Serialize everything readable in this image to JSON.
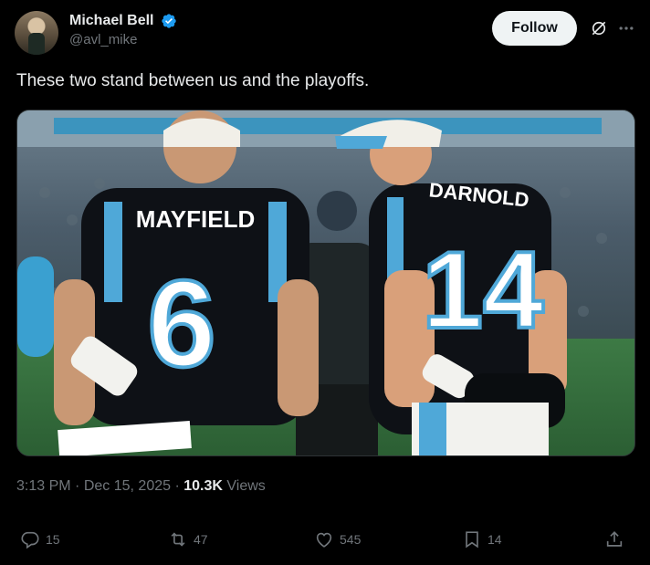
{
  "author": {
    "display_name": "Michael Bell",
    "handle": "@avl_mike",
    "verified": true
  },
  "follow_label": "Follow",
  "icons": {
    "verified": "verified-badge-icon",
    "grok": "grok-icon",
    "more": "more-icon",
    "reply": "reply-icon",
    "retweet": "retweet-icon",
    "like": "heart-icon",
    "bookmark": "bookmark-icon",
    "share": "share-icon"
  },
  "tweet": {
    "text": "These two stand between us and the playoffs.",
    "time": "3:13 PM",
    "separator": "·",
    "date": "Dec 15, 2025",
    "views_count": "10.3K",
    "views_label": "Views"
  },
  "photo": {
    "jersey_left_name": "MAYFIELD",
    "jersey_left_number": "6",
    "jersey_right_name": "DARNOLD",
    "jersey_right_number": "14"
  },
  "actions": {
    "replies": "15",
    "retweets": "47",
    "likes": "545",
    "bookmarks": "14"
  },
  "colors": {
    "background": "#000000",
    "follow_bg": "#eff3f4",
    "verified": "#1d9bf0",
    "muted": "#71767b",
    "panthers_blue": "#4fa8d8"
  }
}
